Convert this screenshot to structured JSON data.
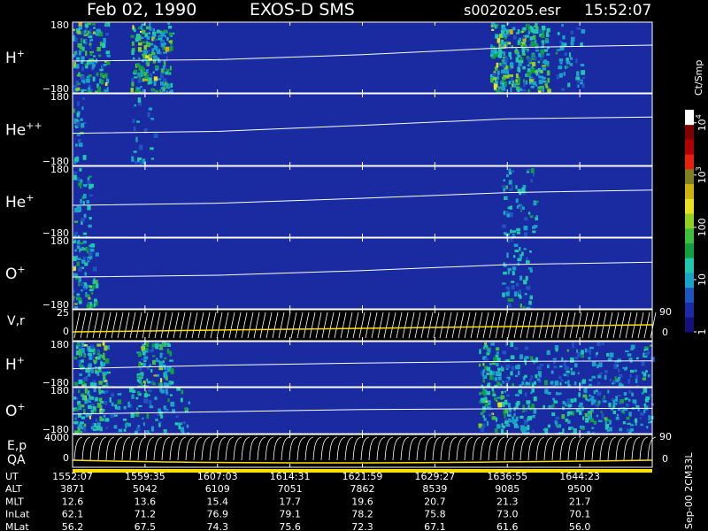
{
  "header": {
    "date": "Feb 02, 1990",
    "mission": "EXOS-D SMS",
    "file": "s0020205.esr",
    "time": "15:52:07"
  },
  "colorbar": {
    "unit_label": "Ct/Smp",
    "ticks": [
      {
        "label": "1",
        "value": 1
      },
      {
        "label": "10",
        "value": 10
      },
      {
        "label": "100",
        "value": 100
      },
      {
        "label": "10",
        "sup": "3",
        "value": 1000
      },
      {
        "label": "10",
        "sup": "4",
        "value": 10000
      }
    ],
    "colors": [
      "#12127a",
      "#1a2aa8",
      "#1f55c0",
      "#1aa3c8",
      "#20c8b0",
      "#10a040",
      "#40c040",
      "#90d020",
      "#e8e020",
      "#d0b010",
      "#808020",
      "#e82010",
      "#b00000",
      "#800000",
      "#ffffff"
    ]
  },
  "footer": {
    "version": "Sep-00 2CM33L",
    "rows": [
      {
        "label": "UT",
        "values": [
          "1552:07",
          "1559:35",
          "1607:03",
          "1614:31",
          "1621:59",
          "1629:27",
          "1636:55",
          "1644:23"
        ]
      },
      {
        "label": "ALT",
        "values": [
          "3871",
          "5042",
          "6109",
          "7051",
          "7862",
          "8539",
          "9085",
          "9500"
        ]
      },
      {
        "label": "MLT",
        "values": [
          "12.6",
          "13.6",
          "15.4",
          "17.7",
          "19.6",
          "20.7",
          "21.3",
          "21.7"
        ]
      },
      {
        "label": "InLat",
        "values": [
          "62.1",
          "71.2",
          "76.9",
          "79.1",
          "78.2",
          "75.8",
          "73.0",
          "70.1"
        ]
      },
      {
        "label": "MLat",
        "values": [
          "56.2",
          "67.5",
          "74.3",
          "75.6",
          "72.3",
          "67.1",
          "61.6",
          "56.0"
        ]
      }
    ]
  },
  "chart_data": {
    "type": "heatmap",
    "x_ticks": [
      "1552:07",
      "1559:35",
      "1607:03",
      "1614:31",
      "1621:59",
      "1629:27",
      "1636:55",
      "1644:23"
    ],
    "panels": [
      {
        "id": "h-plus",
        "ion": "H",
        "charge": "+",
        "ymax": "180",
        "ymin": "−180",
        "ylim": [
          -180,
          180
        ],
        "background": "#1a2aa0",
        "trace": [
          [
            0,
            -0.1
          ],
          [
            0.25,
            -0.06
          ],
          [
            0.5,
            0.08
          ],
          [
            0.75,
            0.28
          ],
          [
            1,
            0.35
          ]
        ],
        "activity": [
          [
            0.0,
            0.06,
            0.8
          ],
          [
            0.1,
            0.17,
            0.9
          ],
          [
            0.72,
            0.82,
            0.95
          ],
          [
            0.83,
            0.88,
            0.3
          ]
        ]
      },
      {
        "id": "he-plus-plus",
        "ion": "He",
        "charge": "++",
        "ymax": "180",
        "ymin": "−180",
        "ylim": [
          -180,
          180
        ],
        "background": "#1a2aa0",
        "trace": [
          [
            0,
            -0.1
          ],
          [
            0.25,
            -0.05
          ],
          [
            0.5,
            0.12
          ],
          [
            0.75,
            0.3
          ],
          [
            1,
            0.35
          ]
        ],
        "activity": [
          [
            0.0,
            0.02,
            0.4
          ],
          [
            0.1,
            0.14,
            0.2
          ]
        ]
      },
      {
        "id": "he-plus",
        "ion": "He",
        "charge": "+",
        "ymax": "180",
        "ymin": "−180",
        "ylim": [
          -180,
          180
        ],
        "background": "#1a2aa0",
        "trace": [
          [
            0,
            -0.1
          ],
          [
            0.25,
            -0.04
          ],
          [
            0.5,
            0.1
          ],
          [
            0.75,
            0.26
          ],
          [
            1,
            0.33
          ]
        ],
        "activity": [
          [
            0.0,
            0.03,
            0.5
          ],
          [
            0.74,
            0.8,
            0.35
          ]
        ]
      },
      {
        "id": "o-plus",
        "ion": "O",
        "charge": "+",
        "ymax": "180",
        "ymin": "−180",
        "ylim": [
          -180,
          180
        ],
        "background": "#1a2aa0",
        "trace": [
          [
            0,
            -0.1
          ],
          [
            0.25,
            -0.05
          ],
          [
            0.5,
            0.08
          ],
          [
            0.75,
            0.25
          ],
          [
            1,
            0.32
          ]
        ],
        "activity": [
          [
            0.0,
            0.04,
            0.7
          ],
          [
            0.74,
            0.79,
            0.35
          ]
        ]
      },
      {
        "id": "h-plus-2",
        "ion": "H",
        "charge": "+",
        "ymax": "180",
        "ymin": "−180",
        "ylim": [
          -180,
          180
        ],
        "background": "#1a2aa0",
        "trace": [
          [
            0,
            -0.2
          ],
          [
            0.25,
            -0.05
          ],
          [
            0.5,
            0.05
          ],
          [
            0.75,
            0.12
          ],
          [
            1,
            0.15
          ]
        ],
        "activity": [
          [
            0.0,
            0.06,
            0.85
          ],
          [
            0.11,
            0.17,
            0.9
          ],
          [
            0.7,
            0.74,
            0.7
          ],
          [
            0.74,
            1.0,
            0.35
          ]
        ]
      },
      {
        "id": "o-plus-2",
        "ion": "O",
        "charge": "+",
        "ymax": "180",
        "ymin": "−180",
        "ylim": [
          -180,
          180
        ],
        "background": "#1a2aa0",
        "trace": [
          [
            0,
            -0.15
          ],
          [
            0.25,
            -0.05
          ],
          [
            0.5,
            0.05
          ],
          [
            0.75,
            0.08
          ],
          [
            1,
            0.1
          ]
        ],
        "activity": [
          [
            0.0,
            0.05,
            0.8
          ],
          [
            0.05,
            0.2,
            0.35
          ],
          [
            0.7,
            0.75,
            0.7
          ],
          [
            0.75,
            1.0,
            0.45
          ]
        ]
      }
    ],
    "line_panels": [
      {
        "id": "v-r",
        "label": "V,r",
        "ymax": "25",
        "ymin": "0",
        "ylim": [
          0,
          25
        ],
        "right_top": "90",
        "right_bottom": "0"
      },
      {
        "id": "e-p",
        "label": "E,p",
        "label2": "QA",
        "ymax": "4000",
        "ymin": "0",
        "ylim": [
          0,
          4000
        ],
        "right_top": "90",
        "right_bottom": "0"
      }
    ]
  }
}
